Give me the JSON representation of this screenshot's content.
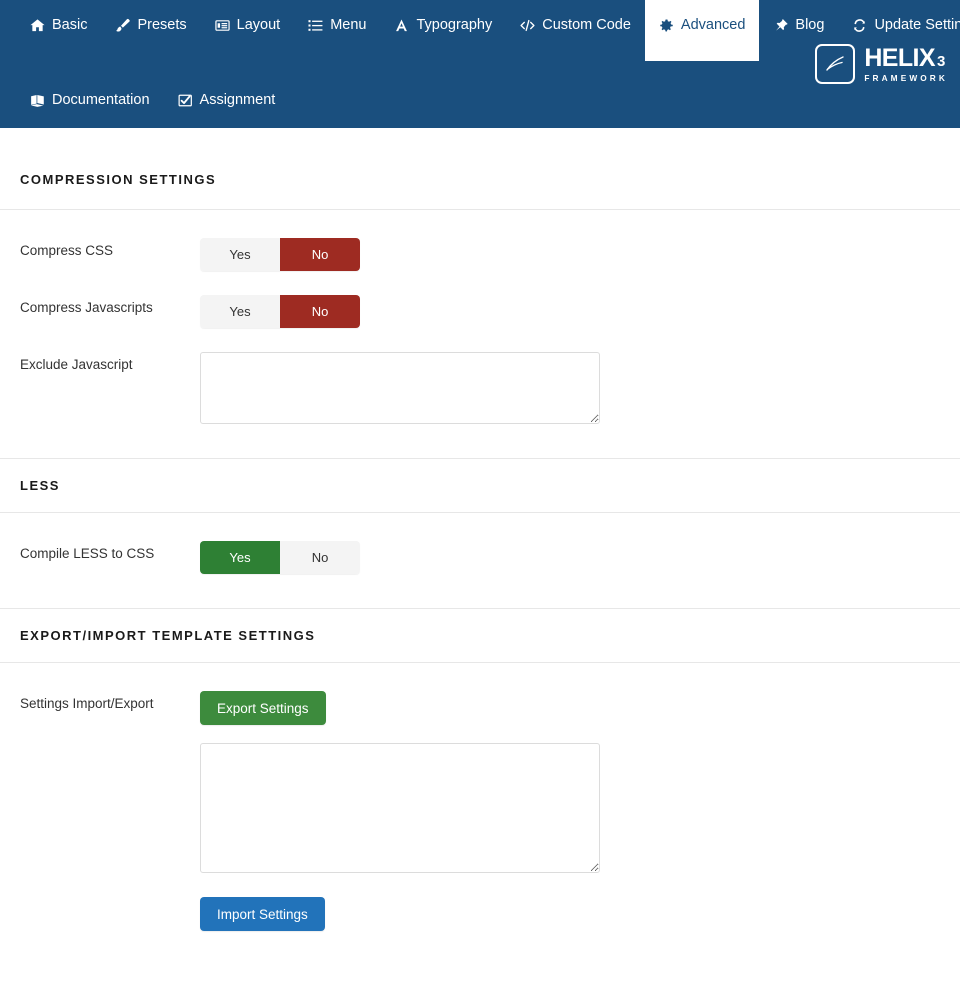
{
  "nav": {
    "rows": [
      [
        {
          "label": "Basic",
          "icon": "home-icon",
          "active": false
        },
        {
          "label": "Presets",
          "icon": "brush-icon",
          "active": false
        },
        {
          "label": "Layout",
          "icon": "layout-icon",
          "active": false
        },
        {
          "label": "Menu",
          "icon": "list-icon",
          "active": false
        },
        {
          "label": "Typography",
          "icon": "font-a-icon",
          "active": false
        },
        {
          "label": "Custom Code",
          "icon": "code-icon",
          "active": false
        },
        {
          "label": "Advanced",
          "icon": "gear-icon",
          "active": true
        },
        {
          "label": "Blog",
          "icon": "pin-icon",
          "active": false
        },
        {
          "label": "Update Settings",
          "icon": "refresh-icon",
          "active": false
        }
      ],
      [
        {
          "label": "Documentation",
          "icon": "book-icon",
          "active": false
        },
        {
          "label": "Assignment",
          "icon": "checkbox-checked-icon",
          "active": false
        }
      ]
    ]
  },
  "logo": {
    "name": "HELIX",
    "version": "3",
    "subtitle": "FRAMEWORK"
  },
  "sections": {
    "compression": {
      "title": "COMPRESSION SETTINGS",
      "compress_css": {
        "label": "Compress CSS",
        "yes_label": "Yes",
        "no_label": "No",
        "value": "No"
      },
      "compress_js": {
        "label": "Compress Javascripts",
        "yes_label": "Yes",
        "no_label": "No",
        "value": "No"
      },
      "exclude_js": {
        "label": "Exclude Javascript",
        "value": "",
        "placeholder": ""
      }
    },
    "less": {
      "title": "LESS",
      "compile_less": {
        "label": "Compile LESS to CSS",
        "yes_label": "Yes",
        "no_label": "No",
        "value": "Yes"
      }
    },
    "export_import": {
      "title": "EXPORT/IMPORT TEMPLATE SETTINGS",
      "settings_io": {
        "label": "Settings Import/Export",
        "export_label": "Export Settings",
        "import_label": "Import Settings",
        "textarea_value": "",
        "textarea_placeholder": ""
      }
    }
  },
  "colors": {
    "navbar": "#1a4f7e",
    "toggle_yes": "#2e8034",
    "toggle_no": "#9e2b22",
    "btn_green": "#3d8b3d",
    "btn_blue": "#2273ba"
  }
}
